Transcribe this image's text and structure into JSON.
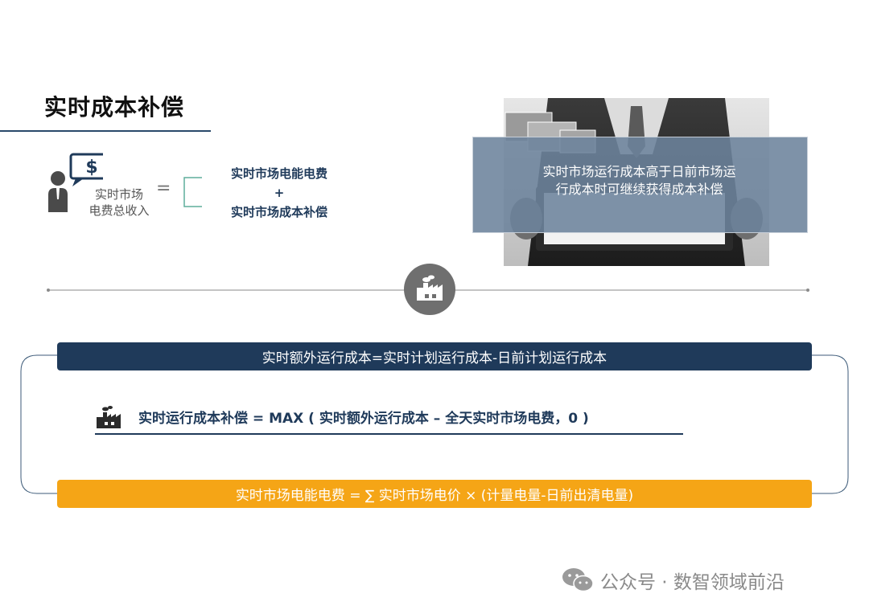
{
  "title": "实时成本补偿",
  "revenue": {
    "label_line1": "实时市场",
    "label_line2": "电费总收入",
    "currency_symbol": "$",
    "equals": "=",
    "term1": "实时市场电能电费",
    "plus": "+",
    "term2": "实时市场成本补偿"
  },
  "photo": {
    "caption_line1": "实时市场运行成本高于日前市场运",
    "caption_line2": "行成本时可继续获得成本补偿"
  },
  "formulas": {
    "extra_cost": "实时额外运行成本=实时计划运行成本-日前计划运行成本",
    "compensation": "实时运行成本补偿 = MAX ( 实时额外运行成本 – 全天实时市场电费，0 )",
    "energy_fee": "实时市场电能电费  = ∑ 实时市场电价 × (计量电量-日前出清电量)"
  },
  "colors": {
    "navy": "#1f3a5a",
    "orange": "#f5a516",
    "gray": "#6f6f6f"
  },
  "watermark": {
    "text": "公众号 · 数智领域前沿",
    "icon": "wechat-icon"
  }
}
